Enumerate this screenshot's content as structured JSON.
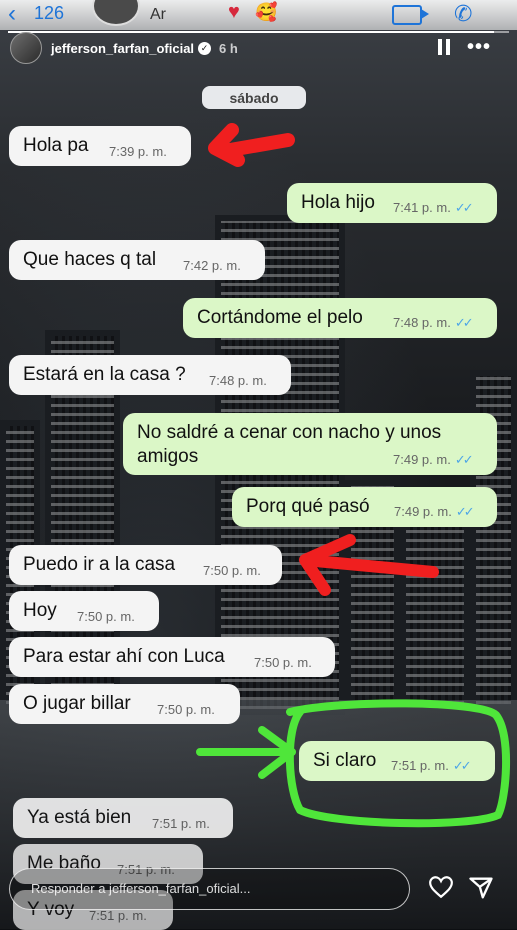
{
  "top_header": {
    "back_count": "126",
    "ar_label": "Ar",
    "heart": "♥",
    "face_emoji": "🥰"
  },
  "story": {
    "progress": 0.97,
    "username": "jefferson_farfan_oficial",
    "time_ago": "6 h",
    "more_label": "•••"
  },
  "chat": {
    "date": "sábado",
    "messages": [
      {
        "dir": "in",
        "text": "Hola pa",
        "time": "7:39 p. m."
      },
      {
        "dir": "out",
        "text": "Hola hijo",
        "time": "7:41 p. m."
      },
      {
        "dir": "in",
        "text": "Que haces q tal",
        "time": "7:42 p. m."
      },
      {
        "dir": "out",
        "text": "Cortándome el pelo",
        "time": "7:48 p. m."
      },
      {
        "dir": "in",
        "text": "Estará en la casa ?",
        "time": "7:48 p. m."
      },
      {
        "dir": "out",
        "text": "No saldré a cenar con nacho y unos amigos",
        "time": "7:49 p. m."
      },
      {
        "dir": "out",
        "text": "Porq qué pasó",
        "time": "7:49 p. m."
      },
      {
        "dir": "in",
        "text": "Puedo ir a la casa",
        "time": "7:50 p. m."
      },
      {
        "dir": "in",
        "text": "Hoy",
        "time": "7:50 p. m."
      },
      {
        "dir": "in",
        "text": "Para estar ahí con Luca",
        "time": "7:50 p. m."
      },
      {
        "dir": "in",
        "text": "O jugar billar",
        "time": "7:50 p. m."
      },
      {
        "dir": "out",
        "text": "Si claro",
        "time": "7:51 p. m."
      },
      {
        "dir": "in",
        "text": "Ya está bien",
        "time": "7:51 p. m."
      },
      {
        "dir": "in",
        "text": "Me baño",
        "time": "7:51 p. m."
      },
      {
        "dir": "in",
        "text": "Y voy",
        "time": "7:51 p. m."
      }
    ],
    "tick_mark": "✓✓"
  },
  "reply": {
    "placeholder": "Responder a jefferson_farfan_oficial..."
  },
  "colors": {
    "incoming_bubble": "#f4f4f4",
    "outgoing_bubble": "#dbf7c7",
    "read_ticks": "#4fa6e6",
    "annotation_red": "#f01f1f",
    "annotation_green": "#4fe63a",
    "header_accent": "#1e74d8"
  }
}
